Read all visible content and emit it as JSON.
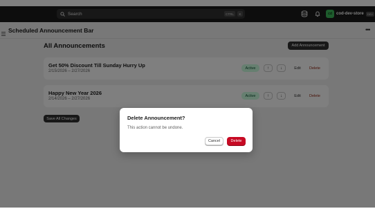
{
  "topbar": {
    "search_label": "Search",
    "shortcut_ctrl": "CTRL",
    "shortcut_key": "K",
    "store_name": "cod-dev-store",
    "store_initials": "cd",
    "store_badge": "DEV"
  },
  "app": {
    "title": "Scheduled Announcement Bar"
  },
  "main": {
    "heading": "All Announcements",
    "add_button": "Add Announcement",
    "save_all_button": "Save All Changes",
    "announcements": [
      {
        "name": "Get 50% Discount Till Sunday Hurry Up",
        "dates": "2/15/2026 – 2/27/2026",
        "status": "Active",
        "up": "↑",
        "down": "↓",
        "edit": "Edit",
        "delete": "Delete"
      },
      {
        "name": "Happy New Year 2026",
        "dates": "2/14/2026 – 2/27/2026",
        "status": "Active",
        "up": "↑",
        "down": "↓",
        "edit": "Edit",
        "delete": "Delete"
      }
    ]
  },
  "modal": {
    "title": "Delete Announcement?",
    "body": "This action cannot be undone.",
    "cancel": "Cancel",
    "confirm": "Delete"
  },
  "colors": {
    "topbar_bg": "#1a1a1a",
    "active_badge_bg": "#cdfee1",
    "danger": "#c70a24",
    "store_avatar": "#3db85a"
  },
  "icons": {
    "search": "search-icon",
    "database": "database-icon",
    "bell": "bell-icon",
    "menu": "menu-icon",
    "more": "more-icon"
  }
}
